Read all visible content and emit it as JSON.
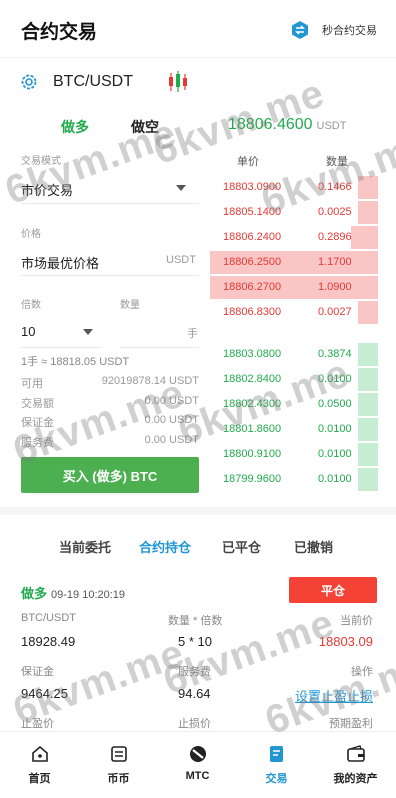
{
  "header": {
    "title": "合约交易",
    "second_contract_label": "秒合约交易"
  },
  "pair": {
    "symbol": "BTC/USDT"
  },
  "side_tabs": {
    "long": "做多",
    "short": "做空"
  },
  "last_price": {
    "value": "18806.4600",
    "unit": "USDT"
  },
  "form": {
    "trade_mode_label": "交易模式",
    "trade_mode_value": "市价交易",
    "price_label": "价格",
    "price_value": "市场最优价格",
    "price_unit": "USDT",
    "leverage_label": "倍数",
    "leverage_value": "10",
    "quantity_label": "数量",
    "quantity_unit": "手",
    "lot_info": "1手 ≈ 18818.05 USDT",
    "available_label": "可用",
    "available_value": "92019878.14 USDT",
    "turnover_label": "交易额",
    "turnover_value": "0.00 USDT",
    "margin_label": "保证金",
    "margin_value": "0.00 USDT",
    "fee_label": "服务费",
    "fee_value": "0.00 USDT",
    "buy_button": "买入 (做多) BTC"
  },
  "orderbook": {
    "price_header": "单价",
    "qty_header": "数量",
    "asks": [
      {
        "price": "18803.0900",
        "qty": "0.1466",
        "depth": 0.12
      },
      {
        "price": "18805.1400",
        "qty": "0.0025",
        "depth": 0.12
      },
      {
        "price": "18806.2400",
        "qty": "0.2896",
        "depth": 0.16
      },
      {
        "price": "18806.2500",
        "qty": "1.1700",
        "depth": 1.0
      },
      {
        "price": "18806.2700",
        "qty": "1.0900",
        "depth": 1.0
      },
      {
        "price": "18806.8300",
        "qty": "0.0027",
        "depth": 0.12
      }
    ],
    "bids": [
      {
        "price": "18803.0800",
        "qty": "0.3874",
        "depth": 0.12
      },
      {
        "price": "18802.8400",
        "qty": "0.0100",
        "depth": 0.12
      },
      {
        "price": "18802.4300",
        "qty": "0.0500",
        "depth": 0.12
      },
      {
        "price": "18801.8600",
        "qty": "0.0100",
        "depth": 0.12
      },
      {
        "price": "18800.9100",
        "qty": "0.0100",
        "depth": 0.12
      },
      {
        "price": "18799.9600",
        "qty": "0.0100",
        "depth": 0.12
      }
    ]
  },
  "order_tabs": [
    "当前委托",
    "合约持仓",
    "已平仓",
    "已撤销"
  ],
  "active_order_tab": 1,
  "position": {
    "direction": "做多",
    "time": "09-19 10:20:19",
    "close_button": "平仓",
    "pair_label": "BTC/USDT",
    "open_price": "18928.49",
    "qty_lev_label": "数量 * 倍数",
    "qty_lev_value": "5 * 10",
    "current_price_label": "当前价",
    "current_price_value": "18803.09",
    "margin_label": "保证金",
    "margin_value": "9464.25",
    "fee_label": "服务费",
    "fee_value": "94.64",
    "action_label": "操作",
    "action_link": "设置止盈止损",
    "tp_label": "止盈价",
    "sl_label": "止损价",
    "est_pnl_label": "预期盈利"
  },
  "bottom_nav": [
    {
      "label": "首页",
      "icon": "home-icon"
    },
    {
      "label": "币币",
      "icon": "exchange-icon"
    },
    {
      "label": "MTC",
      "icon": "mtc-icon"
    },
    {
      "label": "交易",
      "icon": "trade-icon"
    },
    {
      "label": "我的资产",
      "icon": "wallet-icon"
    }
  ],
  "watermark": "6kvm.me",
  "colors": {
    "green": "#22ab4d",
    "red": "#e53935",
    "blue": "#2196d3",
    "ask_bg": "#f9c5c5",
    "bid_bg": "#c6ecd2",
    "buy_button": "#4caf50",
    "close_button": "#f44336"
  }
}
